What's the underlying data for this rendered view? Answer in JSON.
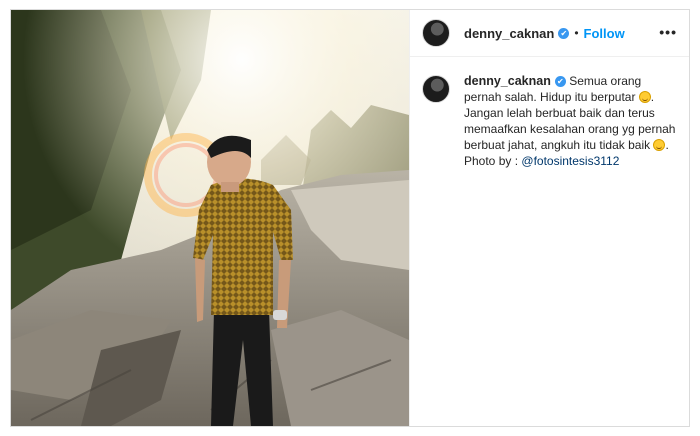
{
  "post": {
    "username": "denny_caknan",
    "follow_label": "Follow",
    "more_label": "•••",
    "verified_mark": "✔",
    "separator": "•",
    "caption_part1": "Semua orang pernah salah. Hidup itu berputar",
    "caption_part2": ". Jangan lelah berbuat baik dan terus memaafkan kesalahan orang yg pernah berbuat jahat, angkuh itu tidak baik",
    "caption_part3": ".",
    "photo_by_label": "Photo by :",
    "photo_by_handle": "@fotosintesis3112"
  },
  "icons": {
    "verified": "verified-badge-icon",
    "emoji": "smiling-face-icon",
    "more": "more-options-icon"
  },
  "colors": {
    "follow": "#0095f6",
    "verified": "#3897f0",
    "mention": "#00376b",
    "text": "#262626"
  }
}
